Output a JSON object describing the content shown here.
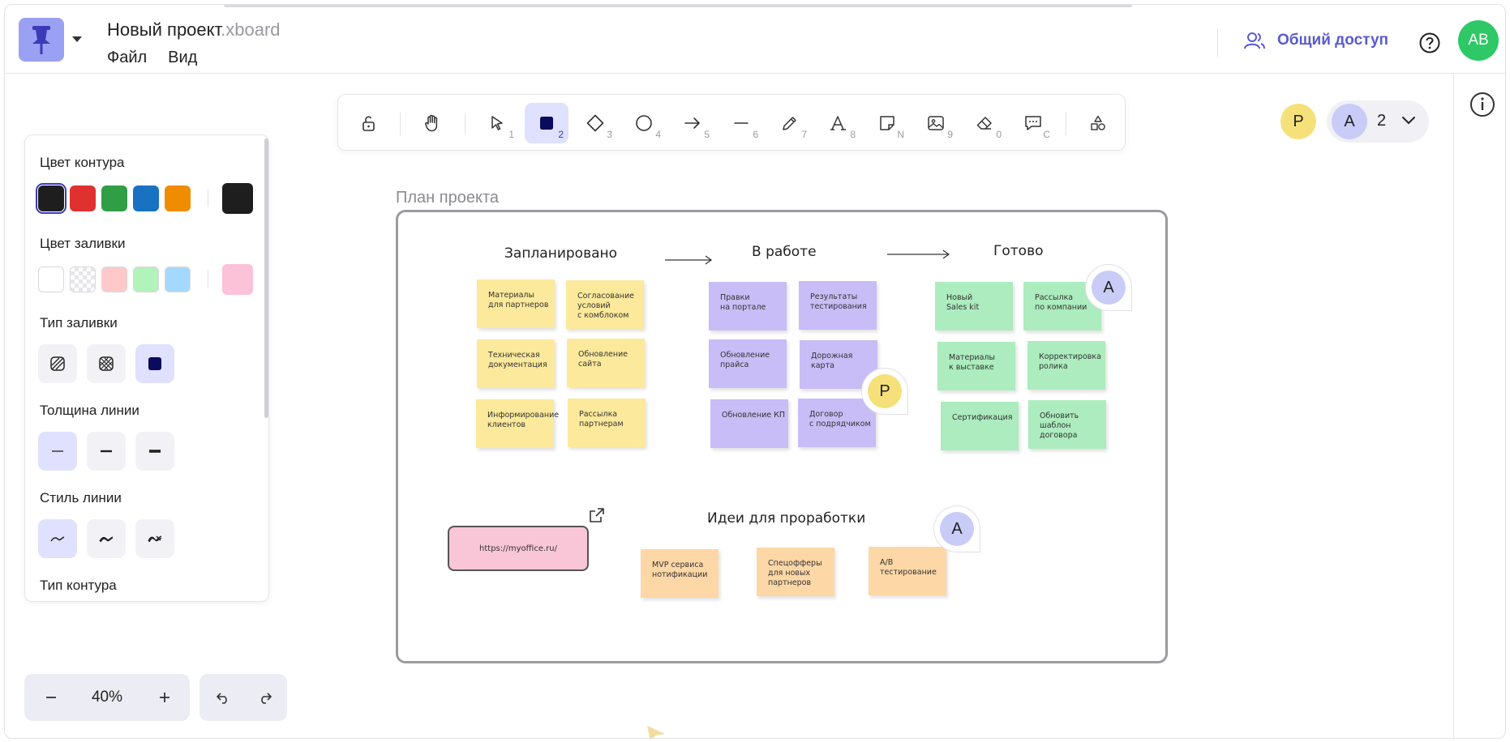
{
  "header": {
    "project_name": "Новый проект",
    "extension": ".xboard",
    "menu": [
      "Файл",
      "Вид"
    ],
    "share_label": "Общий доступ",
    "user_initials": "AB"
  },
  "toolbar": {
    "tools": [
      {
        "name": "lock-tool",
        "key": ""
      },
      {
        "name": "hand-tool",
        "key": ""
      },
      {
        "name": "select-tool",
        "key": "1"
      },
      {
        "name": "rectangle-tool",
        "key": "2"
      },
      {
        "name": "diamond-tool",
        "key": "3"
      },
      {
        "name": "ellipse-tool",
        "key": "4"
      },
      {
        "name": "arrow-tool",
        "key": "5"
      },
      {
        "name": "line-tool",
        "key": "6"
      },
      {
        "name": "pencil-tool",
        "key": "7"
      },
      {
        "name": "text-tool",
        "key": "8"
      },
      {
        "name": "sticky-note-tool",
        "key": "N"
      },
      {
        "name": "image-tool",
        "key": "9"
      },
      {
        "name": "eraser-tool",
        "key": "0"
      },
      {
        "name": "comment-tool",
        "key": "C"
      },
      {
        "name": "shapes-library-tool",
        "key": ""
      }
    ],
    "active_tool": "rectangle-tool"
  },
  "collaborators": {
    "first": "P",
    "second": "A",
    "count": "2"
  },
  "panel": {
    "stroke_label": "Цвет контура",
    "stroke_colors": [
      "#1e1e1e",
      "#e03131",
      "#2f9e44",
      "#1971c2",
      "#f08c00"
    ],
    "stroke_current": "#1e1e1e",
    "fill_label": "Цвет заливки",
    "fill_colors": [
      "#ffffff",
      "transparent",
      "#ffc9c9",
      "#b2f2bb",
      "#a5d8ff"
    ],
    "fill_current": "#fcc2d7",
    "fill_type_label": "Тип заливки",
    "stroke_width_label": "Толщина линии",
    "stroke_style_label": "Стиль линии",
    "outline_type_label": "Тип контура"
  },
  "zoom": {
    "value": "40%"
  },
  "canvas": {
    "frame_title": "План проекта",
    "columns": [
      "Запланировано",
      "В работе",
      "Готово"
    ],
    "notes_planned": [
      "Материалы\nдля партнеров",
      "Согласование\nусловий\nс комблоком",
      "Техническая\nдокументация",
      "Обновление\nсайта",
      "Информирование\nклиентов",
      "Рассылка\nпартнерам"
    ],
    "notes_in_progress": [
      "Правки\nна портале",
      "Результаты\nтестирования",
      "Обновление\nпрайса",
      "Дорожная\nкарта",
      "Обновление КП",
      "Договор\nс подрядчиком"
    ],
    "notes_done": [
      "Новый\nSales kit",
      "Рассылка\nпо компании",
      "Материалы\nк выставке",
      "Корректировка\nролика",
      "Сертификация",
      "Обновить\nшаблон\nдоговора"
    ],
    "ideas_title": "Идеи для проработки",
    "notes_ideas": [
      "MVP сервиса\nнотификации",
      "Спецофферы\nдля новых\nпартнеров",
      "A/B\nтестирование"
    ],
    "link_text": "https://myoffice.ru/",
    "pin_labels": [
      "A",
      "P",
      "A"
    ],
    "colors": {
      "yellow": "#fce99b",
      "purple": "#c8bdf6",
      "green": "#acecbe",
      "orange": "#fdd7a6",
      "link": "#f8c6d6"
    }
  }
}
